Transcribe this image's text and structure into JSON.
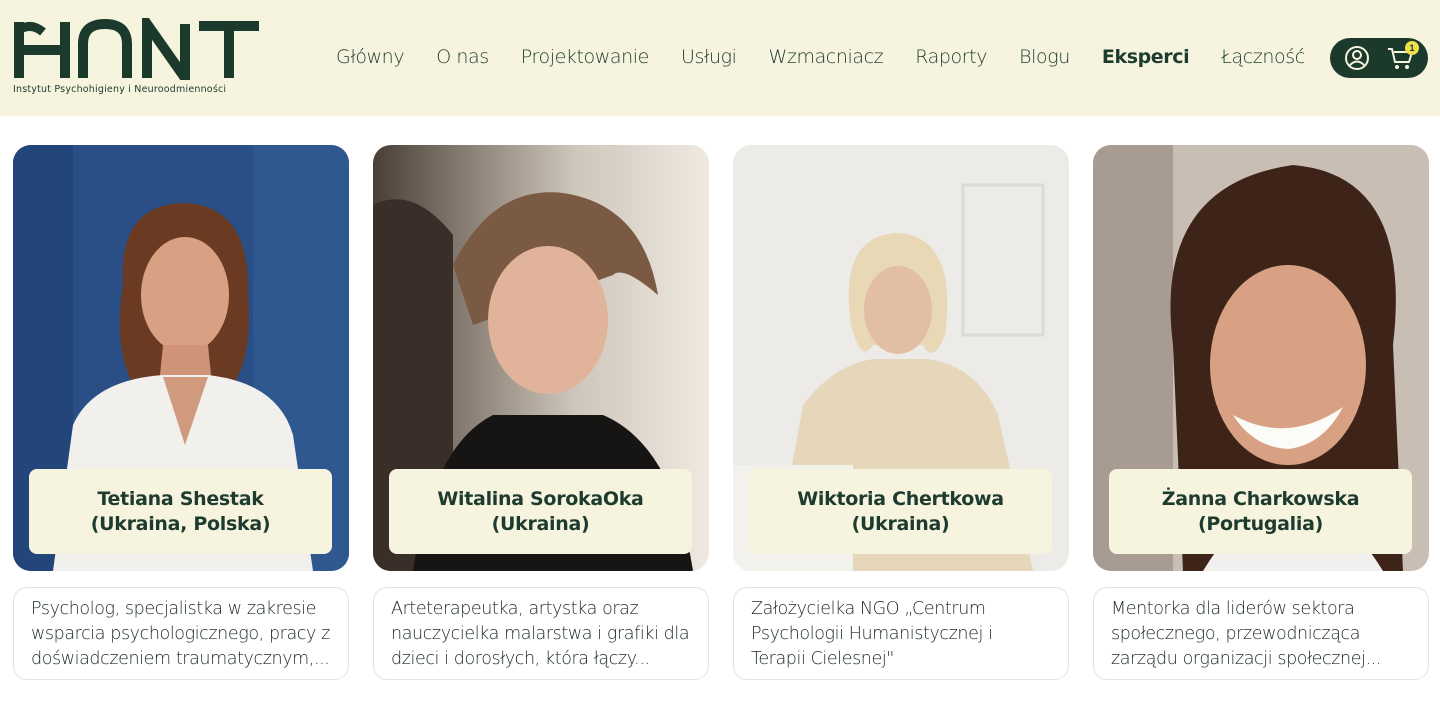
{
  "brand": {
    "logo_text": "HNNT",
    "tagline": "Instytut Psychohigieny i Neuroodmienności",
    "color": "#1c3a2c"
  },
  "nav": {
    "items": [
      {
        "label": "Główny"
      },
      {
        "label": "O nas"
      },
      {
        "label": "Projektowanie"
      },
      {
        "label": "Usługi"
      },
      {
        "label": "Wzmacniacz"
      },
      {
        "label": "Raporty"
      },
      {
        "label": "Blogu"
      },
      {
        "label": "Eksperci",
        "active": true
      },
      {
        "label": "Łączność"
      }
    ]
  },
  "header_actions": {
    "user_icon": "user-circle-icon",
    "cart_icon": "cart-icon",
    "cart_count": "1"
  },
  "experts": [
    {
      "name": "Tetiana Shestak (Ukraina, Polska)",
      "description": "Psycholog, specjalistka w zakresie wsparcia psychologicznego, pracy z doświadczeniem traumatycznym,...",
      "photo_icon": "portrait-photo"
    },
    {
      "name": "Witalina SorokaOka (Ukraina)",
      "description": "Arteterapeutka, artystka oraz nauczycielka malarstwa i grafiki dla dzieci i dorosłych, która łączy...",
      "photo_icon": "portrait-photo"
    },
    {
      "name": "Wiktoria Chertkowa (Ukraina)",
      "description": "Założycielka NGO „Centrum Psychologii Humanistycznej i Terapii Cielesnej\"",
      "photo_icon": "portrait-photo"
    },
    {
      "name": "Żanna Charkowska (Portugalia)",
      "description": "Mentorka dla liderów sektora społecznego, przewodnicząca zarządu organizacji społecznej...",
      "photo_icon": "portrait-photo"
    }
  ],
  "colors": {
    "header_bg": "#f6f4df",
    "accent_dark": "#1c3a2c",
    "badge": "#f2e04a"
  }
}
